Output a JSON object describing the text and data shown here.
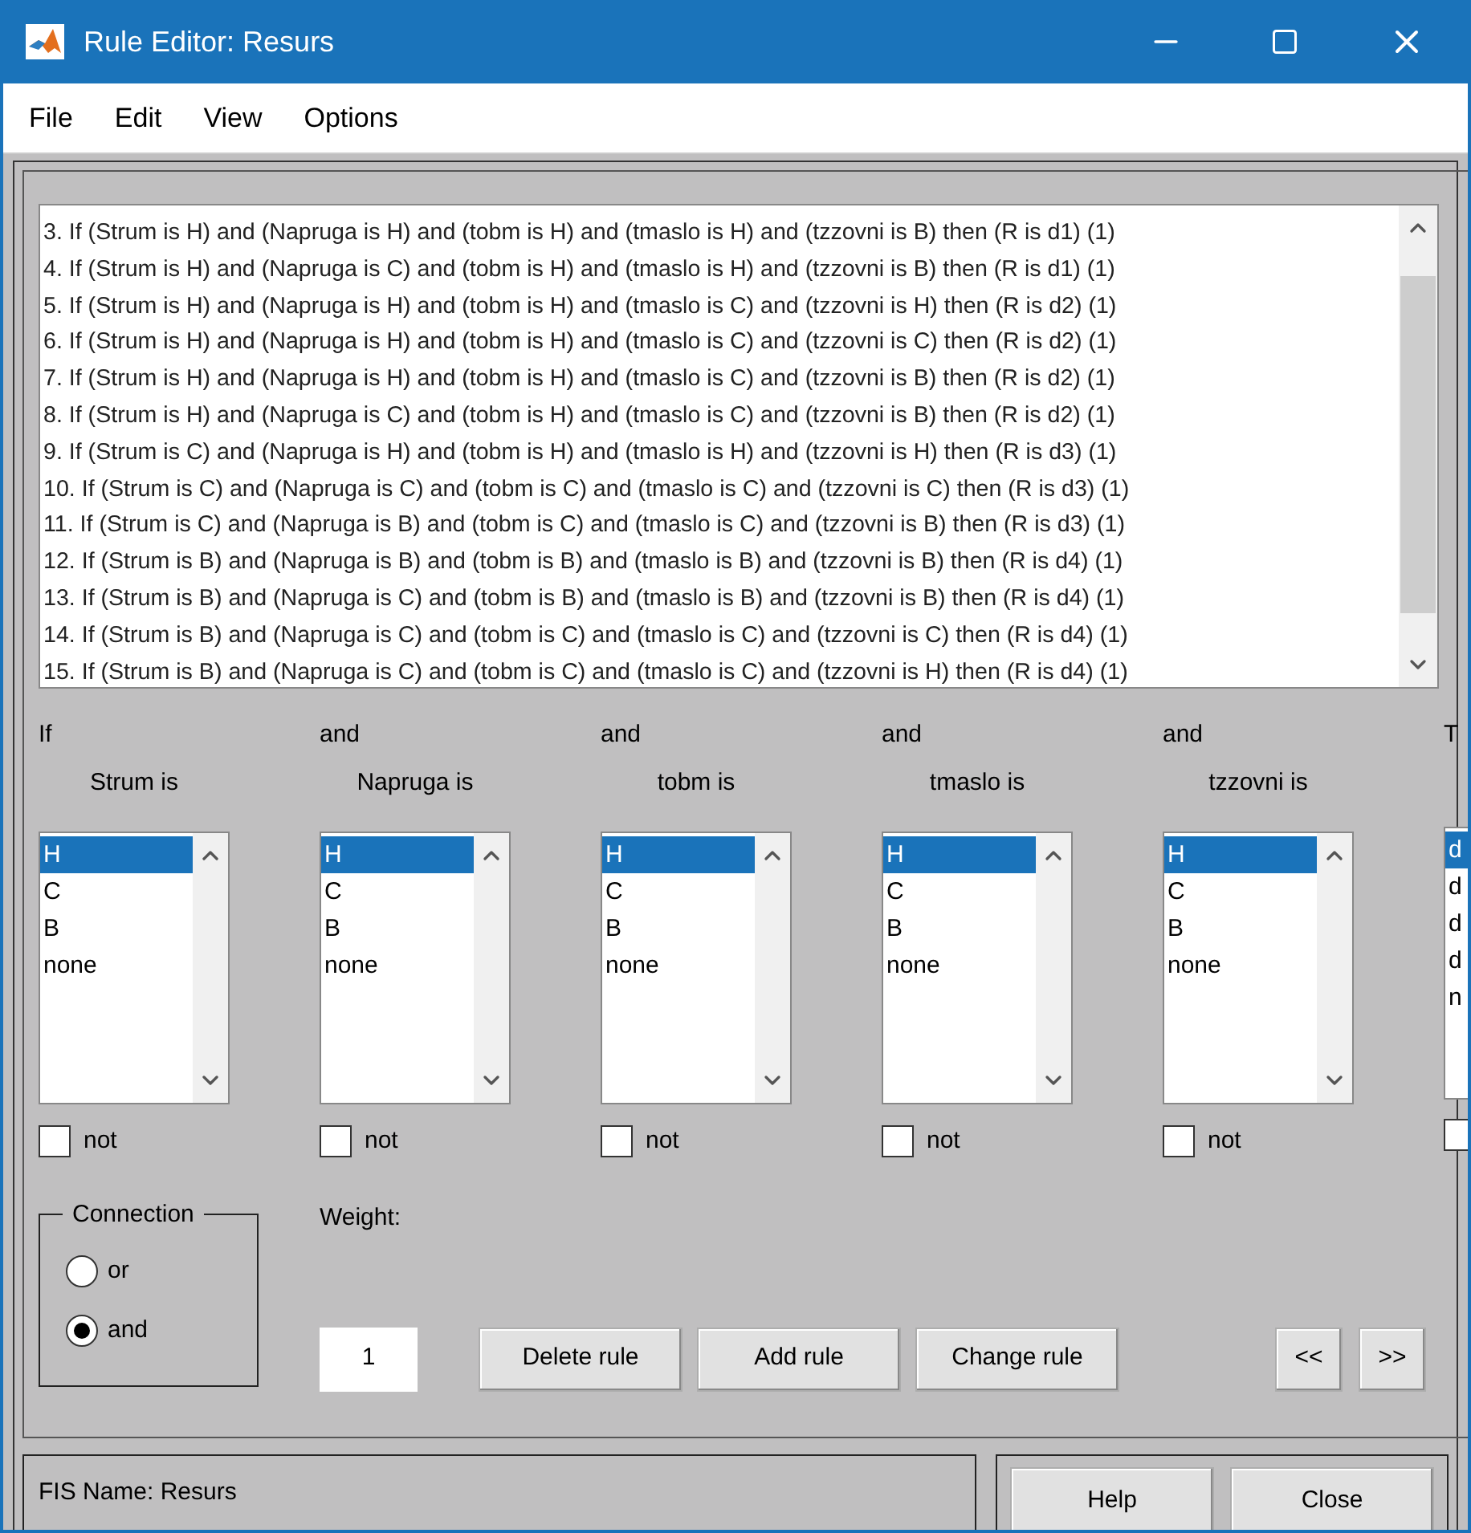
{
  "window": {
    "title": "Rule Editor: Resurs"
  },
  "menu": [
    "File",
    "Edit",
    "View",
    "Options"
  ],
  "rules": [
    "3. If (Strum is H) and (Napruga is H) and (tobm is H) and (tmaslo is H) and (tzzovni is B) then (R is d1) (1)",
    "4. If (Strum is H) and (Napruga is C) and (tobm is H) and (tmaslo is H) and (tzzovni is B) then (R is d1) (1)",
    "5. If (Strum is H) and (Napruga is H) and (tobm is H) and (tmaslo is C) and (tzzovni is H) then (R is d2) (1)",
    "6. If (Strum is H) and (Napruga is H) and (tobm is H) and (tmaslo is C) and (tzzovni is C) then (R is d2) (1)",
    "7. If (Strum is H) and (Napruga is H) and (tobm is H) and (tmaslo is C) and (tzzovni is B) then (R is d2) (1)",
    "8. If (Strum is H) and (Napruga is C) and (tobm is H) and (tmaslo is C) and (tzzovni is B) then (R is d2) (1)",
    "9. If (Strum is C) and (Napruga is H) and (tobm is H) and (tmaslo is H) and (tzzovni is H) then (R is d3) (1)",
    "10. If (Strum is C) and (Napruga is C) and (tobm is C) and (tmaslo is C) and (tzzovni is C) then (R is d3) (1)",
    "11. If (Strum is C) and (Napruga is B) and (tobm is C) and (tmaslo is C) and (tzzovni is B) then (R is d3) (1)",
    "12. If (Strum is B) and (Napruga is B) and (tobm is B) and (tmaslo is B) and (tzzovni is B) then (R is d4) (1)",
    "13. If (Strum is B) and (Napruga is C) and (tobm is B) and (tmaslo is B) and (tzzovni is B) then (R is d4) (1)",
    "14. If (Strum is B) and (Napruga is C) and (tobm is C) and (tmaslo is C) and (tzzovni is C) then (R is d4) (1)",
    "15. If (Strum is B) and (Napruga is C) and (tobm is C) and (tmaslo is C) and (tzzovni is H) then (R is d4) (1)"
  ],
  "antecedents": [
    {
      "connector": "If",
      "label": "Strum is",
      "options": [
        {
          "text": "H",
          "selected": true
        },
        {
          "text": "C",
          "selected": false
        },
        {
          "text": "B",
          "selected": false
        },
        {
          "text": "none",
          "selected": false
        }
      ],
      "not": {
        "label": "not",
        "checked": false
      }
    },
    {
      "connector": "and",
      "label": "Napruga is",
      "options": [
        {
          "text": "H",
          "selected": true
        },
        {
          "text": "C",
          "selected": false
        },
        {
          "text": "B",
          "selected": false
        },
        {
          "text": "none",
          "selected": false
        }
      ],
      "not": {
        "label": "not",
        "checked": false
      }
    },
    {
      "connector": "and",
      "label": "tobm is",
      "options": [
        {
          "text": "H",
          "selected": true
        },
        {
          "text": "C",
          "selected": false
        },
        {
          "text": "B",
          "selected": false
        },
        {
          "text": "none",
          "selected": false
        }
      ],
      "not": {
        "label": "not",
        "checked": false
      }
    },
    {
      "connector": "and",
      "label": "tmaslo is",
      "options": [
        {
          "text": "H",
          "selected": true
        },
        {
          "text": "C",
          "selected": false
        },
        {
          "text": "B",
          "selected": false
        },
        {
          "text": "none",
          "selected": false
        }
      ],
      "not": {
        "label": "not",
        "checked": false
      }
    },
    {
      "connector": "and",
      "label": "tzzovni is",
      "options": [
        {
          "text": "H",
          "selected": true
        },
        {
          "text": "C",
          "selected": false
        },
        {
          "text": "B",
          "selected": false
        },
        {
          "text": "none",
          "selected": false
        }
      ],
      "not": {
        "label": "not",
        "checked": false
      }
    }
  ],
  "consequent": {
    "connector": "T",
    "options": [
      {
        "text": "d",
        "selected": true
      },
      {
        "text": "d",
        "selected": false
      },
      {
        "text": "d",
        "selected": false
      },
      {
        "text": "d",
        "selected": false
      },
      {
        "text": "n",
        "selected": false
      }
    ],
    "not_checked": false
  },
  "connection": {
    "title": "Connection",
    "options": [
      {
        "label": "or",
        "selected": false
      },
      {
        "label": "and",
        "selected": true
      }
    ]
  },
  "weight": {
    "label": "Weight:",
    "value": "1"
  },
  "rule_buttons": [
    "Delete rule",
    "Add rule",
    "Change rule"
  ],
  "nav_buttons": [
    "<<",
    ">>"
  ],
  "fis_name": "FIS Name: Resurs",
  "footer_buttons": [
    "Help",
    "Close"
  ]
}
